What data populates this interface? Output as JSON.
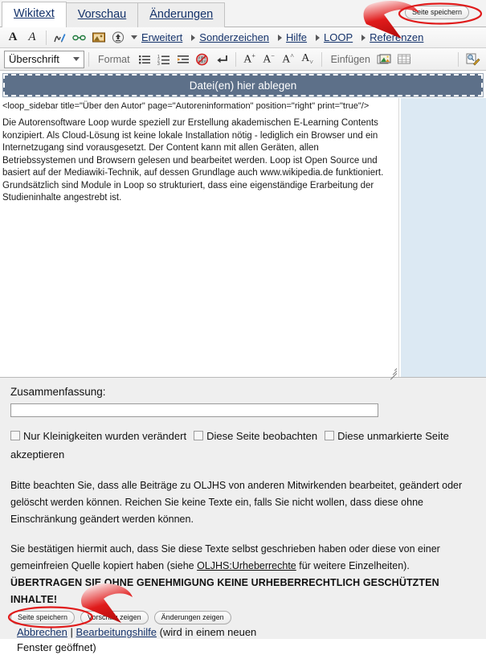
{
  "tabs": [
    {
      "label": "Wikitext",
      "active": true
    },
    {
      "label": "Vorschau",
      "active": false
    },
    {
      "label": "Änderungen",
      "active": false
    }
  ],
  "top_save_button": "Seite speichern",
  "toolbar_row1": {
    "bold_icon": "bold-icon",
    "italic_icon": "italic-icon",
    "signature_icon": "signature-icon",
    "link_icon": "link-icon",
    "embedded_file_icon": "embedded-file-icon",
    "upload_icon": "upload-icon",
    "menus": [
      "Erweitert",
      "Sonderzeichen",
      "Hilfe",
      "LOOP",
      "Referenzen"
    ]
  },
  "toolbar_row2": {
    "heading_select": "Überschrift",
    "format_label": "Format",
    "bullet_list_icon": "bullet-list-icon",
    "numbered_list_icon": "numbered-list-icon",
    "indent_icon": "indent-icon",
    "nowiki_icon": "nowiki-icon",
    "newline_icon": "newline-icon",
    "superscript_icon": "A⁺",
    "subscript_icon": "A⁻",
    "big_icon": "A˄",
    "small_icon": "A˅",
    "insert_label": "Einfügen",
    "image_icon": "image-icon",
    "table_icon": "table-icon",
    "search_replace_icon": "search-replace-icon"
  },
  "dropzone": {
    "label": "Datei(en) hier ablegen"
  },
  "editor": {
    "code_line": "<loop_sidebar title=\"Über den Autor\" page=\"Autoreninformation\" position=\"right\" print=\"true\"/>",
    "body": "Die Autorensoftware Loop wurde speziell zur Erstellung akademischen E-Learning Contents konzipiert. Als Cloud-Lösung ist keine lokale Installation nötig - lediglich ein Browser und ein Internetzugang sind vorausgesetzt. Der Content kann mit allen Geräten, allen Betriebssystemen und Browsern gelesen und bearbeitet werden. Loop ist Open Source und basiert auf der Mediawiki-Technik, auf dessen Grundlage auch www.wikipedia.de funktioniert. Grundsätzlich sind Module in Loop so strukturiert, dass eine eigenständige Erarbeitung der Studieninhalte angestrebt ist."
  },
  "summary": {
    "label": "Zusammenfassung:",
    "value": "",
    "placeholder": ""
  },
  "checkboxes": [
    {
      "label": "Nur Kleinigkeiten wurden verändert",
      "checked": false
    },
    {
      "label": "Diese Seite beobachten",
      "checked": false
    },
    {
      "label": "Diese unmarkierte Seite akzeptieren",
      "checked": false
    }
  ],
  "legal": {
    "paragraph1": "Bitte beachten Sie, dass alle Beiträge zu OLJHS von anderen Mitwirkenden bearbeitet, geändert oder gelöscht werden können. Reichen Sie keine Texte ein, falls Sie nicht wollen, dass diese ohne Einschränkung geändert werden können.",
    "paragraph2_a": "Sie bestätigen hiermit auch, dass Sie diese Texte selbst geschrieben haben oder diese von einer gemeinfreien Quelle kopiert haben (siehe ",
    "paragraph2_link": "OLJHS:Urheberrechte",
    "paragraph2_b": " für weitere Einzelheiten).",
    "warning": "ÜBERTRAGEN SIE OHNE GENEHMIGUNG KEINE URHEBERRECHTLICH GESCHÜTZTEN INHALTE!"
  },
  "footer": {
    "save_button": "Seite speichern",
    "preview_button": "Vorschau zeigen",
    "diff_button": "Änderungen zeigen",
    "cancel_link": "Abbrechen",
    "separator": "|",
    "help_link": "Bearbeitungshilfe",
    "help_suffix": " (wird in einem neuen Fenster geöffnet)"
  },
  "annotations": {
    "color": "#e01b1b",
    "arrow_top": "red-arrow-top",
    "ellipse_top": "red-ellipse-top",
    "arrow_bottom": "red-arrow-bottom",
    "ellipse_bottom": "red-ellipse-bottom"
  }
}
